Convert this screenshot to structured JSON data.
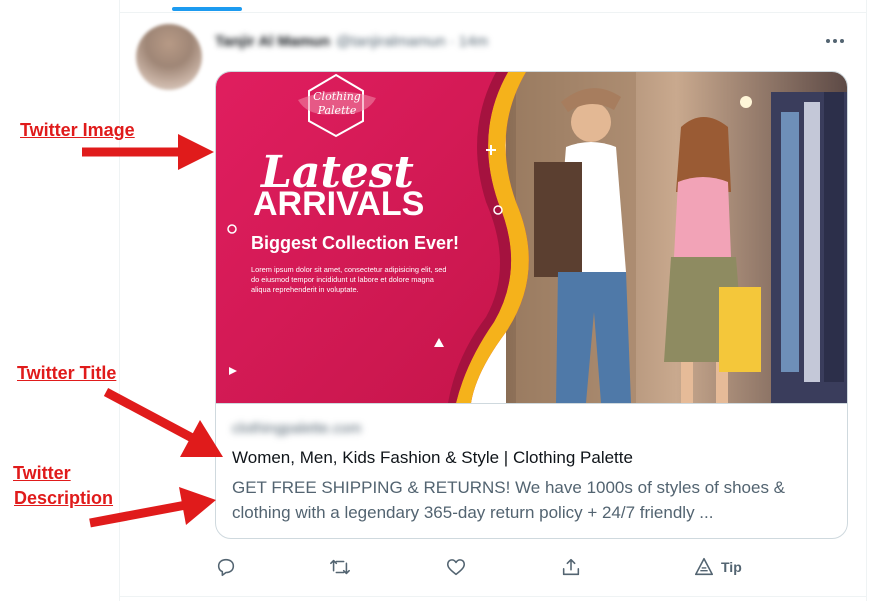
{
  "tweet": {
    "author_name": "Tanjir Al Mamun",
    "author_meta": "@tanjiralmamun · 14m",
    "more_icon": "more-horizontal-icon"
  },
  "card": {
    "image": {
      "logo_text_line1": "Clothing",
      "logo_text_line2": "Palette",
      "headline_script": "Latest",
      "headline_bold": "ARRIVALS",
      "subheadline": "Biggest Collection Ever!",
      "body_text_line1": "Lorem ipsum dolor sit amet, consectetur adipisicing elit, sed",
      "body_text_line2": "do eiusmod tempor incididunt ut labore et dolore magna",
      "body_text_line3": "aliqua reprehenderit in voluptate.",
      "brand_color": "#d91a57",
      "accent_color": "#f5b21b"
    },
    "domain": "clothingpalette.com",
    "title": "Women, Men, Kids Fashion & Style | Clothing Palette",
    "description": "GET FREE SHIPPING & RETURNS! We have 1000s of styles of shoes & clothing with a legendary 365-day return policy + 24/7 friendly ..."
  },
  "actions": {
    "reply_icon": "reply-icon",
    "retweet_icon": "retweet-icon",
    "like_icon": "heart-icon",
    "share_icon": "share-icon",
    "tip_icon": "tip-icon",
    "tip_label": "Tip"
  },
  "annotations": {
    "image_label": "Twitter Image",
    "title_label": "Twitter Title",
    "description_label_line1": "Twitter ",
    "description_label_line2": "Description",
    "annotation_color": "#e01b1b"
  },
  "colors": {
    "accent": "#1d9bf0",
    "text_primary": "#0f1419",
    "text_secondary": "#536471",
    "border": "#cfd9de"
  }
}
